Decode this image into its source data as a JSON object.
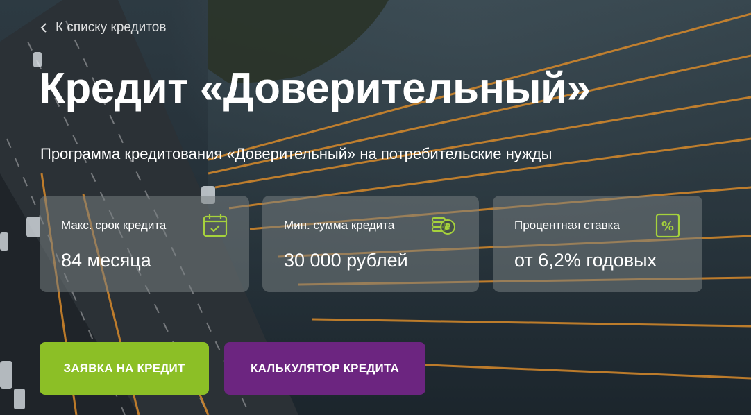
{
  "nav": {
    "back_label": "К списку кредитов"
  },
  "hero": {
    "title": "Кредит «Доверительный»",
    "subtitle": "Программа кредитования «Доверительный» на потребительские нужды"
  },
  "cards": [
    {
      "label": "Макс. срок кредита",
      "value": "84 месяца",
      "icon": "calendar-icon"
    },
    {
      "label": "Мин. сумма кредита",
      "value": "30 000 рублей",
      "icon": "ruble-coins-icon"
    },
    {
      "label": "Процентная ставка",
      "value": "от 6,2% годовых",
      "icon": "percent-icon"
    }
  ],
  "buttons": {
    "apply_label": "ЗАЯВКА НА КРЕДИТ",
    "calculator_label": "КАЛЬКУЛЯТОР КРЕДИТА"
  },
  "colors": {
    "accent_green": "#8cbf26",
    "accent_purple": "#6c2580",
    "icon_green": "#a6d23c"
  }
}
